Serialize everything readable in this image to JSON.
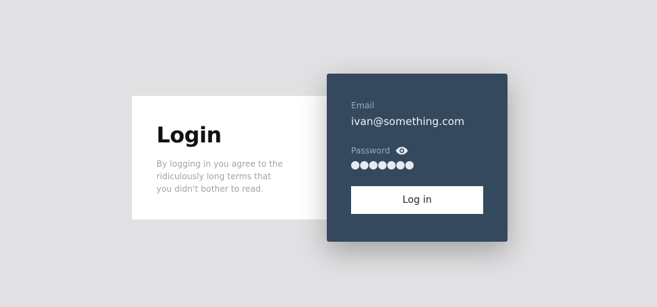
{
  "info": {
    "title": "Login",
    "description": "By logging in you agree to the ridiculously long terms that you didn't bother to read."
  },
  "form": {
    "email_label": "Email",
    "email_value": "ivan@something.com",
    "password_label": "Password",
    "password_icon": "eye-icon",
    "password_length": 7,
    "submit_label": "Log in"
  },
  "colors": {
    "page_background": "#e1e1e3",
    "form_background": "#34495e",
    "card_background": "#ffffff"
  }
}
